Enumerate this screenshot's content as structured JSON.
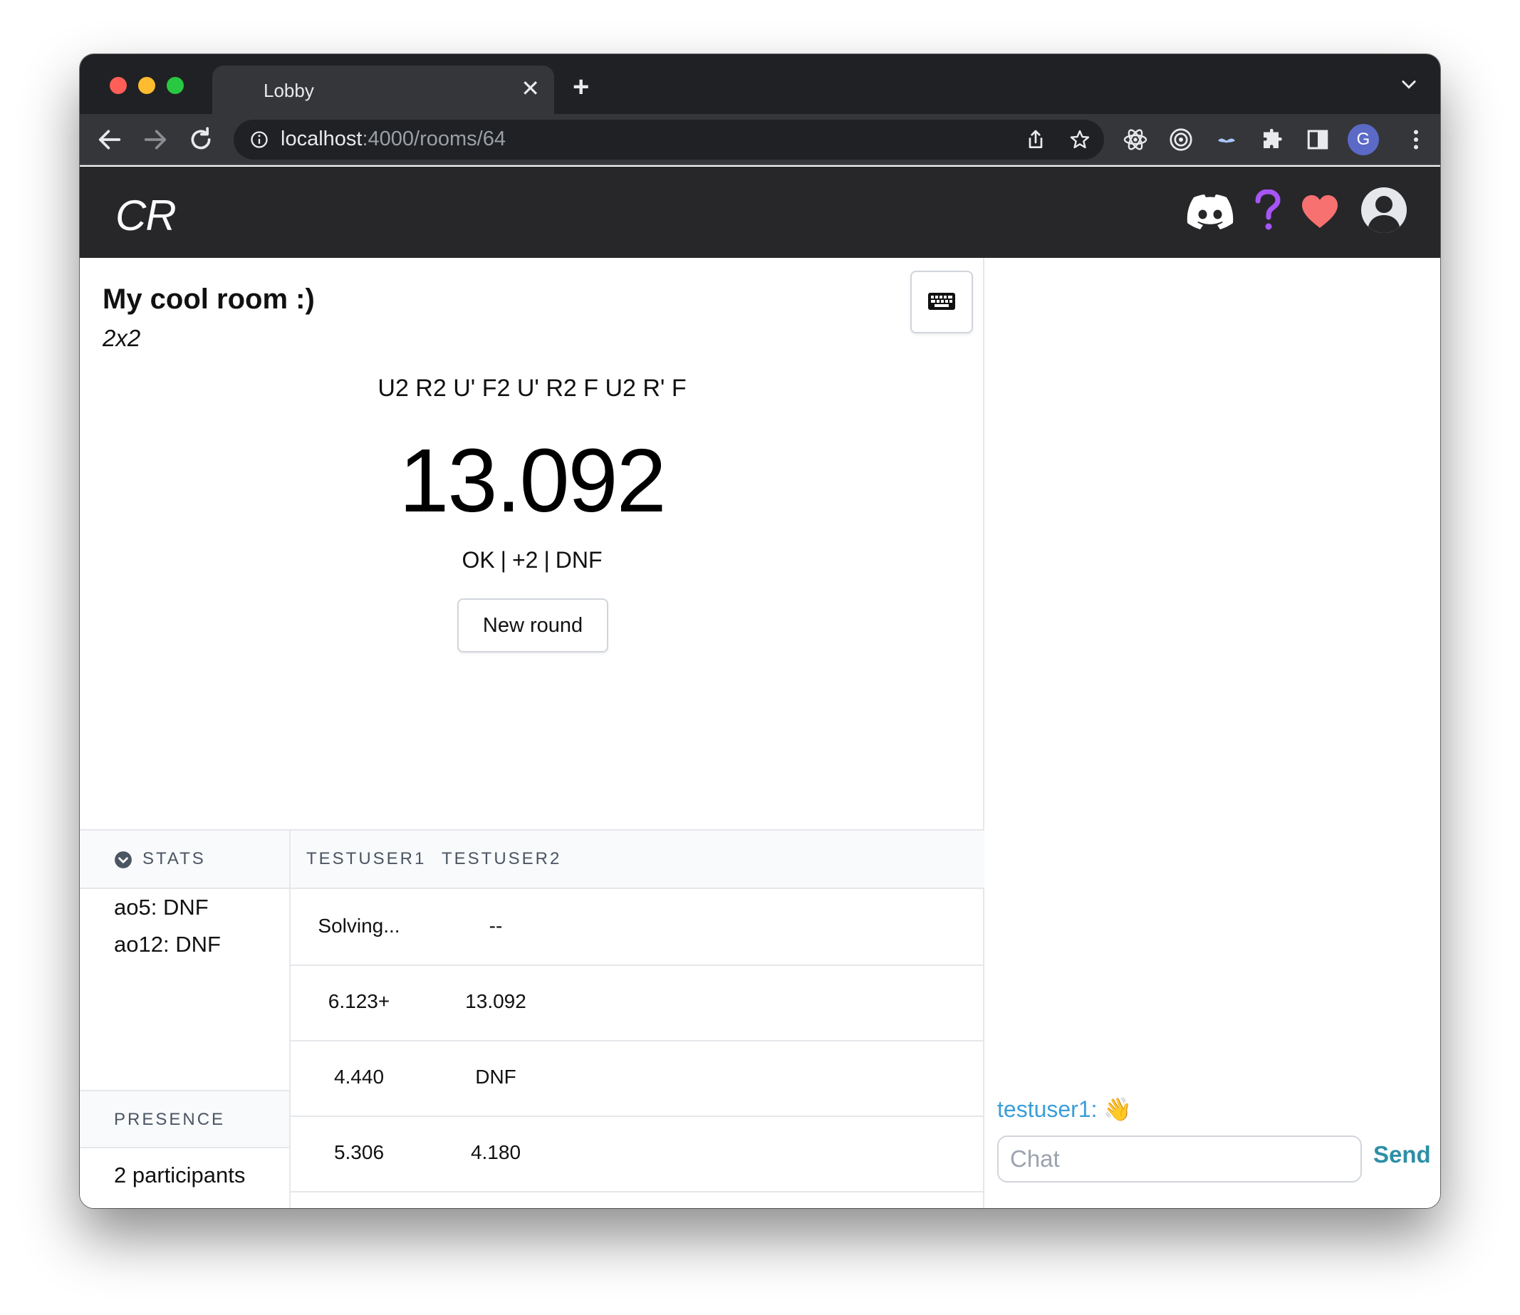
{
  "browser": {
    "tab_title": "Lobby",
    "tab_close": "✕",
    "new_tab": "+",
    "url_host": "localhost",
    "url_path": ":4000/rooms/64",
    "profile_initial": "G"
  },
  "app": {
    "logo": "CR"
  },
  "room": {
    "title": "My cool room :)",
    "puzzle": "2x2",
    "scramble": "U2 R2 U' F2 U' R2 F U2 R' F",
    "time": "13.092",
    "penalty_ok": "OK",
    "penalty_sep1": "|",
    "penalty_plus2": "+2",
    "penalty_sep2": "|",
    "penalty_dnf": "DNF",
    "new_round": "New round"
  },
  "stats": {
    "header": "STATS",
    "ao5": "ao5: DNF",
    "ao12": "ao12: DNF"
  },
  "presence": {
    "header": "PRESENCE",
    "count": "2 participants"
  },
  "table": {
    "columns": [
      "TESTUSER1",
      "TESTUSER2"
    ],
    "rows": [
      [
        "Solving...",
        "--"
      ],
      [
        "6.123+",
        "13.092"
      ],
      [
        "4.440",
        "DNF"
      ],
      [
        "5.306",
        "4.180"
      ]
    ]
  },
  "chat": {
    "messages": [
      {
        "user": "testuser1:",
        "text": "👋"
      }
    ],
    "placeholder": "Chat",
    "send": "Send"
  },
  "colors": {
    "chrome_dark": "#202124",
    "header_bg": "#27272a",
    "discord": "#ffffff",
    "help": "#a855f7",
    "heart": "#f87171",
    "chat_user": "#3b9ed8",
    "send": "#2e8fa6"
  }
}
